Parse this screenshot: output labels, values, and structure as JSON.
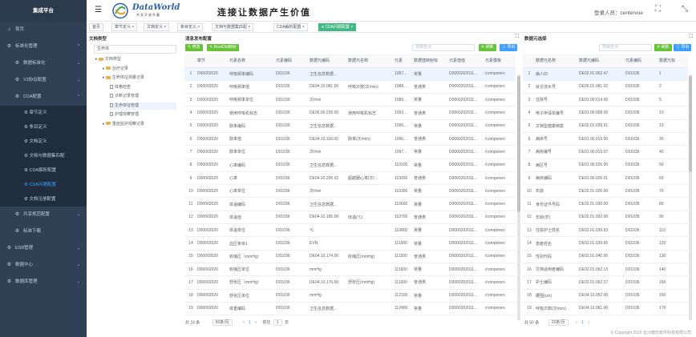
{
  "brand": "集成平台",
  "header": {
    "logo_text": "DataWorld",
    "logo_sub": "共享开放共赢",
    "slogan": "连接让数据产生价值",
    "user": "登录人员：centervue"
  },
  "sidebar": {
    "items": [
      {
        "label": "首页",
        "icon": "⌂",
        "arrow": ""
      },
      {
        "label": "标准化管理",
        "icon": "⚙",
        "arrow": "⌃"
      },
      {
        "label": "数据标准化",
        "icon": "⚙",
        "arrow": "⌄"
      },
      {
        "label": "V3协议配置",
        "icon": "⚙",
        "arrow": "⌄"
      },
      {
        "label": "CDA配置",
        "icon": "⚙",
        "arrow": "⌃"
      }
    ],
    "cda_sub": [
      {
        "label": "章节定义",
        "active": false
      },
      {
        "label": "条目定义",
        "active": false
      },
      {
        "label": "文档定义",
        "active": false
      },
      {
        "label": "文档与数据集匹配",
        "active": false
      },
      {
        "label": "CDA解析配置",
        "active": false
      },
      {
        "label": "CDA问题配置",
        "active": true
      },
      {
        "label": "文档注册配置",
        "active": false
      }
    ],
    "after": [
      {
        "label": "共享规范配置",
        "icon": "⚙",
        "arrow": "⌄",
        "level": 1
      },
      {
        "label": "标准下载",
        "icon": "⚙",
        "arrow": "",
        "level": 1
      },
      {
        "label": "ESB管理",
        "icon": "⚙",
        "arrow": "⌄",
        "level": 0
      },
      {
        "label": "数据中心",
        "icon": "⚙",
        "arrow": "⌄",
        "level": 0
      },
      {
        "label": "数据库管理",
        "icon": "⚙",
        "arrow": "⌄",
        "level": 0
      }
    ]
  },
  "tabs": [
    {
      "label": "首页",
      "closable": false,
      "active": false
    },
    {
      "label": "章节定义 ×",
      "closable": true,
      "active": false
    },
    {
      "label": "文档定义 ×",
      "closable": true,
      "active": false
    },
    {
      "label": "条目定义 ×",
      "closable": true,
      "active": false
    },
    {
      "label": "文档与数据集匹配 ×",
      "closable": true,
      "active": false
    },
    {
      "label": "CDA解析配置 ×",
      "closable": true,
      "active": false
    },
    {
      "label": "● CDA问题配置 ×",
      "closable": true,
      "active": true
    }
  ],
  "tree": {
    "title": "文档类型",
    "search_value": "生命体",
    "nodes": [
      {
        "label": "文档类型",
        "kind": "folder",
        "indent": 0,
        "selected": false
      },
      {
        "label": "治疗记录",
        "kind": "folder",
        "indent": 1,
        "selected": false
      },
      {
        "label": "生命体征测量记录",
        "kind": "folder",
        "indent": 1,
        "selected": false
      },
      {
        "label": "体格检查",
        "kind": "doc",
        "indent": 2,
        "selected": false
      },
      {
        "label": "诊断记录管理",
        "kind": "doc",
        "indent": 2,
        "selected": false
      },
      {
        "label": "生命体征管理",
        "kind": "doc",
        "indent": 2,
        "selected": true
      },
      {
        "label": "护理观察管理",
        "kind": "doc",
        "indent": 2,
        "selected": false
      },
      {
        "label": "重症监护观察记录",
        "kind": "folder",
        "indent": 1,
        "selected": false
      }
    ]
  },
  "mid": {
    "title": "消息发布配置",
    "btn_edit": "✎ 修改",
    "btn_rootoid": "✎ RootOid映射",
    "filter_placeholder": "模糊查询",
    "btn_refresh": "⟳ 刷新",
    "btn_export": "⇩ 导出",
    "columns": [
      "",
      "章节",
      "元素名称",
      "元素编码",
      "数据元编码",
      "数据元名称",
      "元素",
      "数据值映射标",
      "元素值值",
      "元素模板"
    ],
    "rows": [
      [
        "1",
        "D00002020",
        "呼吸频率编码",
        "D01036",
        "卫生信息数据...",
        "",
        "1087...",
        "常量",
        "D0000202011...",
        "/componen"
      ],
      [
        "2",
        "D00002020",
        "呼吸频率值",
        "D01036",
        "DE04.10.081.00",
        "呼吸次数(次/min)",
        "1088...",
        "普通类",
        "D0000202011...",
        "/componen"
      ],
      [
        "3",
        "D00002020",
        "呼吸频率单位",
        "D01036",
        "次/min",
        "",
        "1089...",
        "常量",
        "D0000202011...",
        "/componen"
      ],
      [
        "4",
        "D00002020",
        "使用呼吸机标志",
        "D01036",
        "DE06.00.239.00",
        "使用呼吸机标志",
        "1093...",
        "普通类",
        "D0000202011...",
        "/componen"
      ],
      [
        "5",
        "D00002020",
        "脉率编码",
        "D01036",
        "卫生信息数据...",
        "",
        "1095...",
        "常量",
        "D0000202011...",
        "/componen"
      ],
      [
        "6",
        "D00002020",
        "脉率值",
        "D01036",
        "DE04.10.118.00",
        "脉率(次/min)",
        "1096...",
        "普通类",
        "D0000202011...",
        "/componen"
      ],
      [
        "7",
        "D00002020",
        "脉率单位",
        "D01036",
        "次/min",
        "",
        "1097...",
        "常量",
        "D0000202011...",
        "/componen"
      ],
      [
        "8",
        "D00002020",
        "心率编码",
        "D01036",
        "卫生信息数据...",
        "",
        "110100",
        "常量",
        "D0000202011...",
        "/componen"
      ],
      [
        "9",
        "D00002020",
        "心率",
        "D01036",
        "DE04.10.206.02",
        "超越器心率(次/...",
        "110200",
        "普通类",
        "D0000202011...",
        "/componen"
      ],
      [
        "10",
        "D00002020",
        "心率单位",
        "D01036",
        "次/min",
        "",
        "110300",
        "常量",
        "D0000202011...",
        "/componen"
      ],
      [
        "11",
        "D00002020",
        "体温编码",
        "D01036",
        "卫生信息数据...",
        "",
        "110600",
        "常量",
        "D0000202011...",
        "/componen"
      ],
      [
        "12",
        "D00002020",
        "体温值",
        "D01036",
        "DE04.10.186.00",
        "体温(℃)",
        "110700",
        "普通类",
        "D0000202011...",
        "/componen"
      ],
      [
        "13",
        "D00002020",
        "体温单位",
        "D01036",
        "℃",
        "",
        "110800",
        "常量",
        "D0000202011...",
        "/componen"
      ],
      [
        "14",
        "D00002020",
        "血压条目1",
        "D01036",
        "EVN",
        "",
        "111000",
        "常量",
        "D0000202011...",
        "/componen"
      ],
      [
        "15",
        "D00002020",
        "收缩压（mmHg）",
        "D01036",
        "DE04.10.174.00",
        "收缩压(mmHg)",
        "111500",
        "普通类",
        "D0000202011...",
        "/componen"
      ],
      [
        "16",
        "D00002020",
        "收缩压单位",
        "D01036",
        "mmHg",
        "",
        "111600",
        "常量",
        "D0000202011...",
        "/componen"
      ],
      [
        "17",
        "D00002020",
        "舒张压（mmHg）",
        "D01036",
        "DE04.10.176.00",
        "舒张压(mmHg)",
        "111900",
        "普通类",
        "D0000202011...",
        "/componen"
      ],
      [
        "18",
        "D00002020",
        "舒张压单位",
        "D01036",
        "mmHg",
        "",
        "112100",
        "常量",
        "D0000202011...",
        "/componen"
      ],
      [
        "19",
        "D00002020",
        "体重编码",
        "D01036",
        "卫生信息数据...",
        "",
        "112400",
        "常量",
        "D0000202011...",
        "/componen"
      ]
    ],
    "pager": {
      "total": "共 24 条",
      "size": "50条/页",
      "goto": "前往",
      "page": "1",
      "pages": "页"
    }
  },
  "right": {
    "title": "数据元选择",
    "filter_placeholder": "模糊查询",
    "btn_refresh": "⟳ 刷新",
    "btn_export": "⇩ 导出",
    "columns": [
      "",
      "数据元名称",
      "数据元编码",
      "元素编码",
      "数据元标"
    ],
    "rows": [
      [
        "1",
        "病人ID",
        "DE02.01.062.47",
        "D01036",
        "1"
      ],
      [
        "2",
        "就诊流水号",
        "DE05.01.081.02",
        "D01036",
        "2"
      ],
      [
        "3",
        "住院号",
        "DE01.00.014.00",
        "D01036",
        "5"
      ],
      [
        "4",
        "电子申请单编号",
        "DE01.00.008.00",
        "D01036",
        "10"
      ],
      [
        "5",
        "文档型健康档案",
        "DE02.01.039.91",
        "D01036",
        "10"
      ],
      [
        "6",
        "病床号",
        "DE01.00.019.00",
        "D01036",
        "30"
      ],
      [
        "7",
        "病房编号",
        "DE01.00.019.07",
        "D01036",
        "40"
      ],
      [
        "8",
        "病区号",
        "DE01.00.026.00",
        "D01036",
        "50"
      ],
      [
        "9",
        "病床编码",
        "DE01.00.026.01",
        "D01036",
        "60"
      ],
      [
        "10",
        "年龄",
        "DE02.01.026.00",
        "D01036",
        "70"
      ],
      [
        "11",
        "身份证件号码",
        "DE02.01.030.00",
        "D01036",
        "80"
      ],
      [
        "12",
        "年龄(岁)",
        "DE02.01.032.00",
        "D01036",
        "90"
      ],
      [
        "13",
        "住院护士姓名",
        "DE02.01.039.63",
        "D01036",
        "110"
      ],
      [
        "14",
        "患者姓名",
        "DE02.01.039.65",
        "D01036",
        "120"
      ],
      [
        "15",
        "性别代码",
        "DE02.01.040.00",
        "D01036",
        "130"
      ],
      [
        "16",
        "文档适用者编码",
        "DE02.01.062.13",
        "D01036",
        "140"
      ],
      [
        "17",
        "护士编码",
        "DE02.01.062.27",
        "D01036",
        "150"
      ],
      [
        "18",
        "腰围(cm)",
        "DE04.10.052.00",
        "D01036",
        "160"
      ],
      [
        "19",
        "呼吸次数(次/min)",
        "DE04.10.081.00",
        "D01036",
        "170"
      ]
    ],
    "pager": {
      "total": "共 50 条",
      "size": "20条/页",
      "goto": "前往",
      "page": "1",
      "pages": "页"
    }
  },
  "footer": "© Copyright 2016 长沙康乐软件科技有限公司"
}
